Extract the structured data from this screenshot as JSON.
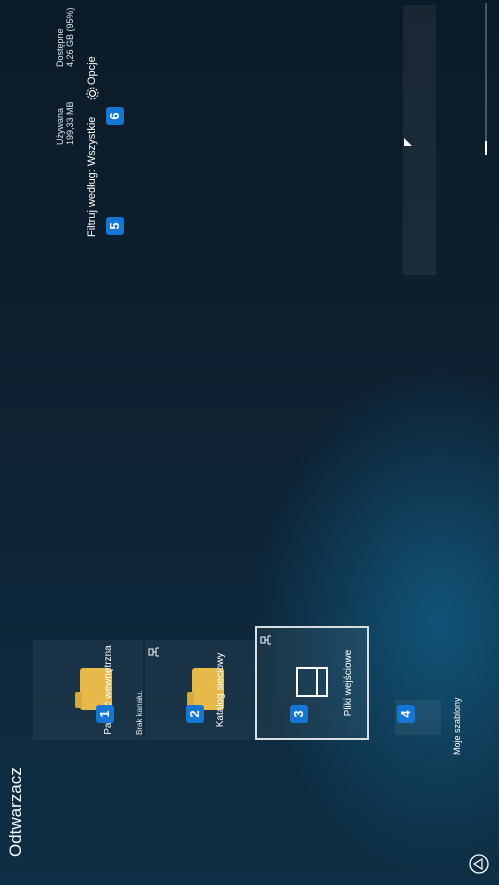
{
  "app": {
    "title": "Odtwarzacz"
  },
  "storage": {
    "used_label": "Używana",
    "used_value": "199,33 MB",
    "available_label": "Dostępne",
    "available_value": "4,26 GB (95%)"
  },
  "toolbar": {
    "filter_label": "Filtruj według: Wszystkie",
    "options_label": "Opcje"
  },
  "sources": [
    {
      "label": "Pamięć wewnętrzna"
    },
    {
      "label": "Katalog sieciowy"
    },
    {
      "label": "Pliki wejściowe"
    }
  ],
  "no_channel_label": "Brak kanału.",
  "bottom": {
    "templates_label": "Moje szablony"
  },
  "badges": [
    "1",
    "2",
    "3",
    "4",
    "5",
    "6"
  ],
  "colors": {
    "badge": "#1477d6",
    "folder": "#e6b94a"
  }
}
